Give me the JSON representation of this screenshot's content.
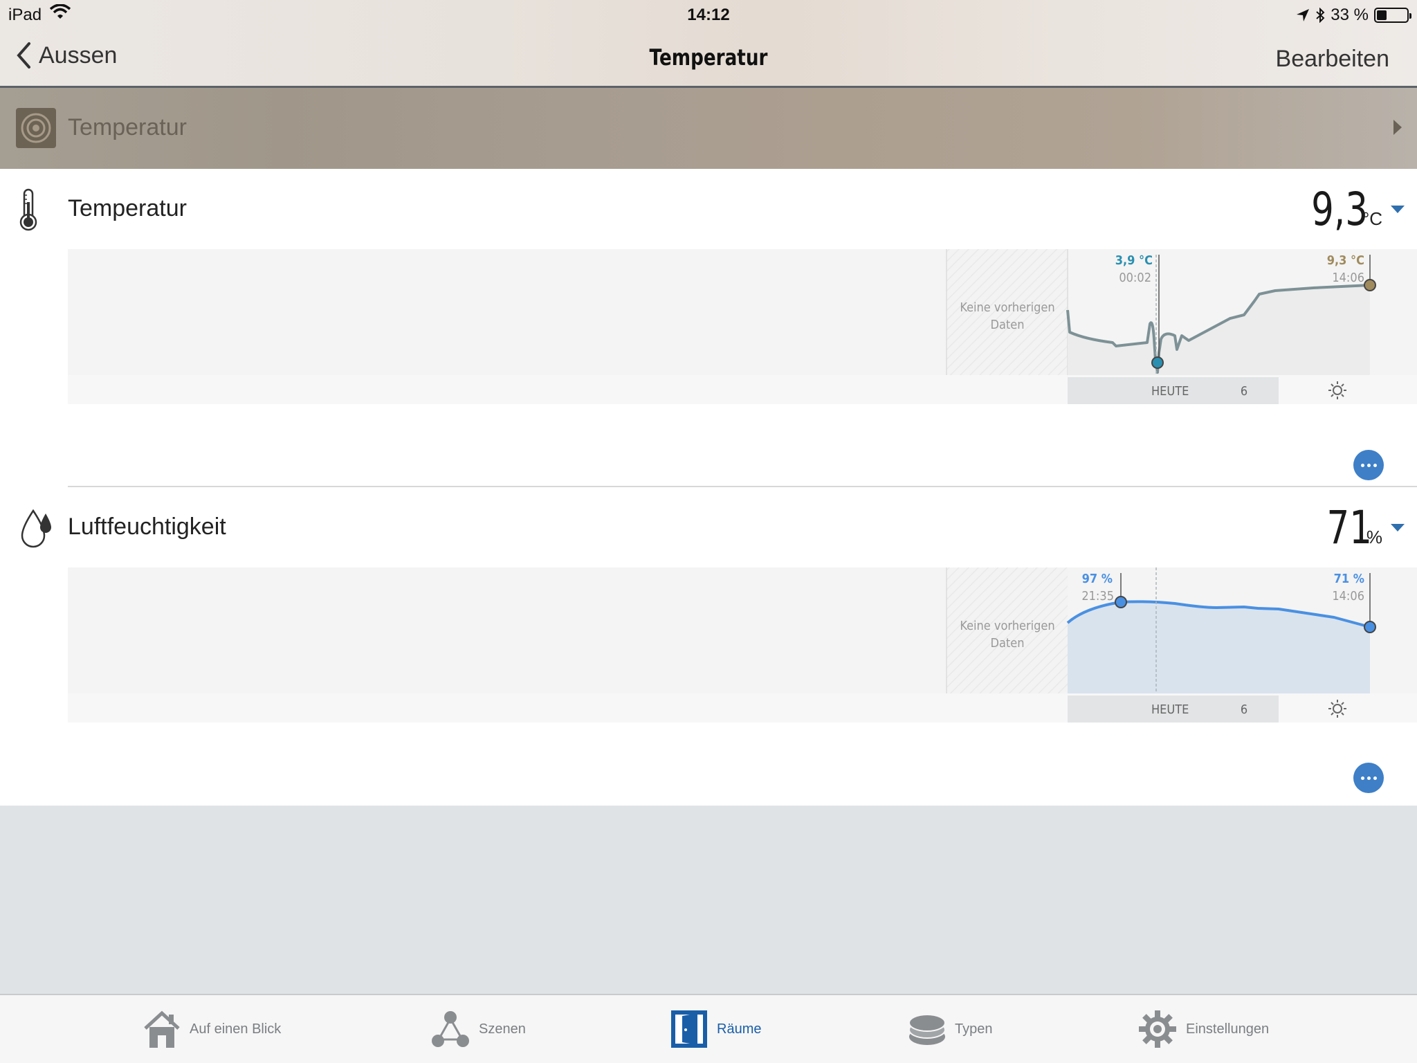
{
  "status_bar": {
    "device": "iPad",
    "time": "14:12",
    "battery": "33 %",
    "battery_level": 0.33
  },
  "nav": {
    "back_label": "Aussen",
    "title": "Temperatur",
    "edit_label": "Bearbeiten"
  },
  "room": {
    "title": "Temperatur"
  },
  "sections": [
    {
      "title": "Temperatur",
      "value": "9,3",
      "unit": "°C",
      "no_data_label": [
        "Keine vorherigen",
        "Daten"
      ],
      "min_label": {
        "value": "3,9 °C",
        "time": "00:02"
      },
      "current_label": {
        "value": "9,3 °C",
        "time": "14:06"
      },
      "axis": {
        "today_label": "HEUTE",
        "hour_label": "6"
      }
    },
    {
      "title": "Luftfeuchtigkeit",
      "value": "71",
      "unit": "%",
      "no_data_label": [
        "Keine vorherigen",
        "Daten"
      ],
      "max_label": {
        "value": "97 %",
        "time": "21:35"
      },
      "current_label": {
        "value": "71 %",
        "time": "14:06"
      },
      "axis": {
        "today_label": "HEUTE",
        "hour_label": "6"
      }
    }
  ],
  "tabs": [
    {
      "label": "Auf einen Blick",
      "icon": "house-icon",
      "active": false
    },
    {
      "label": "Szenen",
      "icon": "scenes-icon",
      "active": false
    },
    {
      "label": "Räume",
      "icon": "door-icon",
      "active": true
    },
    {
      "label": "Typen",
      "icon": "layers-icon",
      "active": false
    },
    {
      "label": "Einstellungen",
      "icon": "gear-icon",
      "active": false
    }
  ],
  "colors": {
    "accent": "#2f6fae",
    "humidity_line": "#4a90e2",
    "temp_line": "#7d9196",
    "min_marker": "#2a8fb0",
    "current_temp_marker": "#a08b5e"
  }
}
